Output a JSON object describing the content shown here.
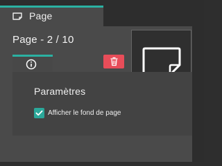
{
  "tab": {
    "label": "Page",
    "icon": "page-icon"
  },
  "panel": {
    "title": "Page - 2 / 10",
    "duplicate_icon": "duplicate-icon",
    "delete_icon": "trash-icon",
    "preview_icon": "page-preview-icon"
  },
  "info_tab": {
    "icon": "info-icon"
  },
  "settings": {
    "title": "Paramètres",
    "checkbox_label": "Afficher le fond de page",
    "checkbox_checked": true
  },
  "colors": {
    "accent": "#2bb1a2",
    "danger": "#e84d59",
    "panel": "#4a4a4a",
    "background": "#2d2d2d"
  }
}
